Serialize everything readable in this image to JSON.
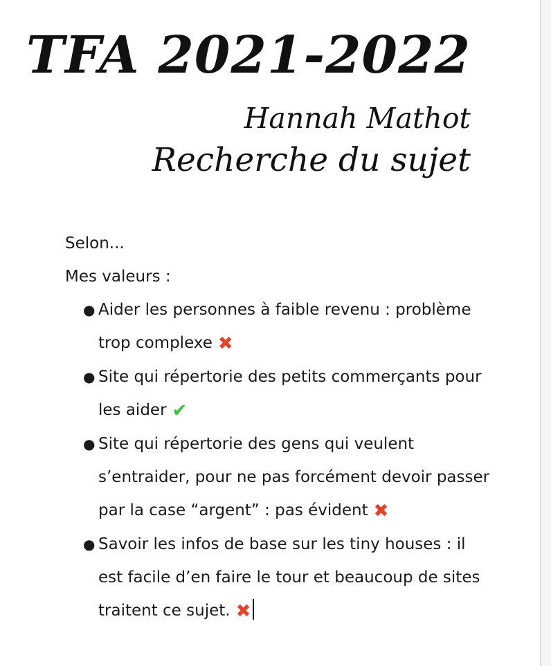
{
  "header": {
    "title": "TFA 2021-2022",
    "author": "Hannah Mathot",
    "subject": "Recherche du sujet"
  },
  "body": {
    "intro": "Selon...",
    "values_label": "Mes valeurs :",
    "items": [
      {
        "text": "Aider les personnes à faible revenu : problème trop complexe",
        "mark": "cross-mark-icon"
      },
      {
        "text": "Site qui répertorie des petits commerçants pour les aider",
        "mark": "check-mark-icon"
      },
      {
        "text": "Site qui répertorie des gens qui veulent s’entraider, pour ne pas forcément devoir passer par la case “argent” : pas évident",
        "mark": "cross-mark-icon"
      },
      {
        "text": "Savoir les infos de base sur les tiny houses : il est facile d’en faire le tour et beaucoup de sites traitent ce sujet.",
        "mark": "cross-mark-icon"
      }
    ]
  },
  "colors": {
    "cross": "#e0442b",
    "check": "#3cbf3c"
  }
}
